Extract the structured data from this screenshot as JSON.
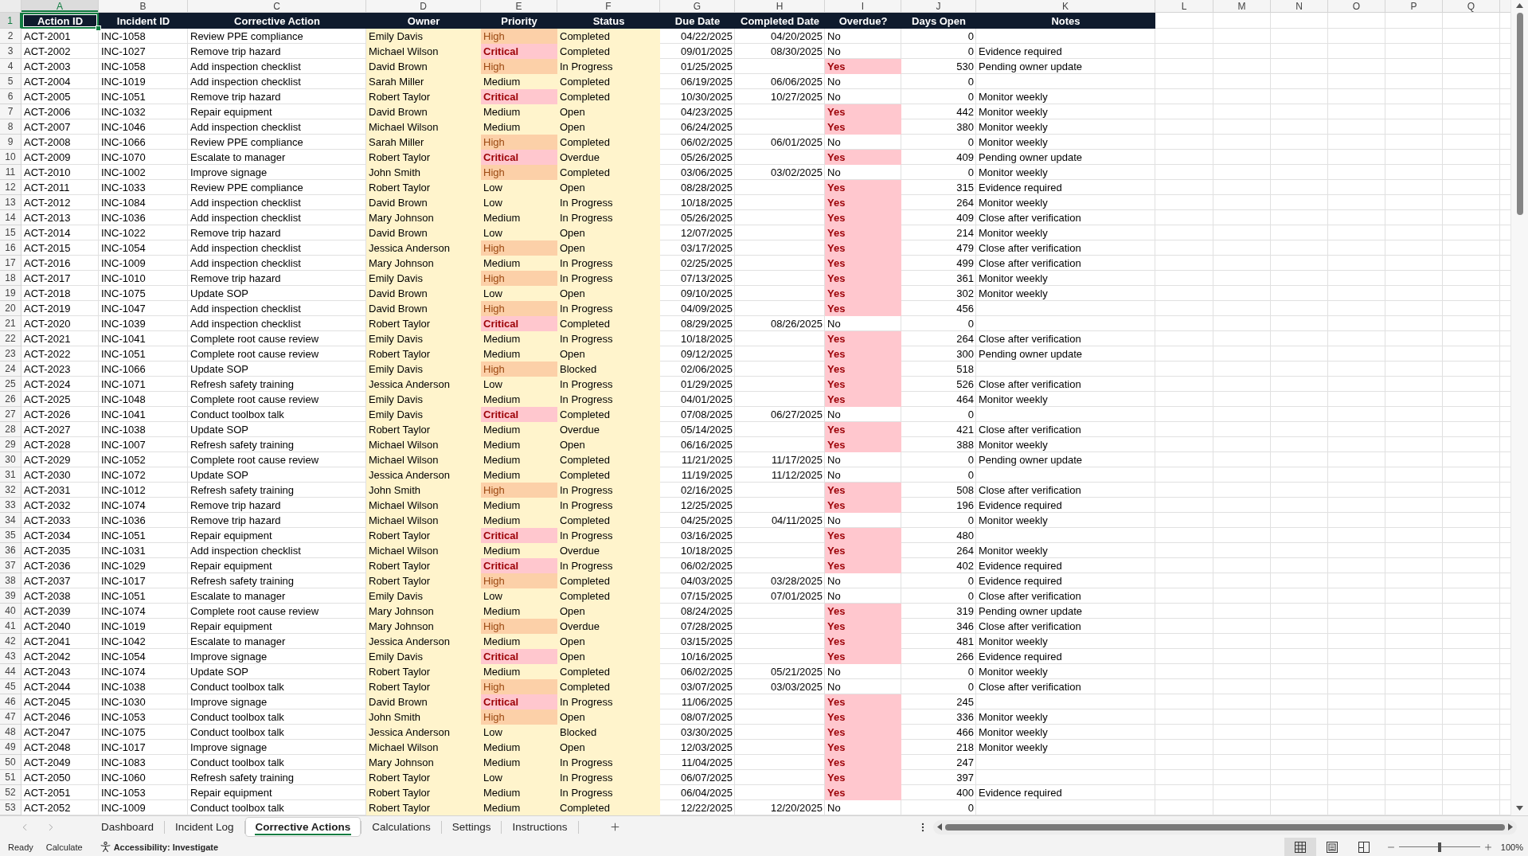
{
  "column_letters": [
    {
      "label": "A",
      "selected": true
    },
    {
      "label": "B",
      "selected": false
    },
    {
      "label": "C",
      "selected": false
    },
    {
      "label": "D",
      "selected": false
    },
    {
      "label": "E",
      "selected": false
    },
    {
      "label": "F",
      "selected": false
    },
    {
      "label": "G",
      "selected": false
    },
    {
      "label": "H",
      "selected": false
    },
    {
      "label": "I",
      "selected": false
    },
    {
      "label": "J",
      "selected": false
    },
    {
      "label": "K",
      "selected": false
    },
    {
      "label": "L",
      "selected": false
    },
    {
      "label": "M",
      "selected": false
    },
    {
      "label": "N",
      "selected": false
    },
    {
      "label": "O",
      "selected": false
    },
    {
      "label": "P",
      "selected": false
    },
    {
      "label": "Q",
      "selected": false
    }
  ],
  "row_headers": [
    {
      "label": "1",
      "selected": true
    },
    {
      "label": "2",
      "selected": false
    },
    {
      "label": "3",
      "selected": false
    },
    {
      "label": "4",
      "selected": false
    },
    {
      "label": "5",
      "selected": false
    },
    {
      "label": "6",
      "selected": false
    },
    {
      "label": "7",
      "selected": false
    },
    {
      "label": "8",
      "selected": false
    },
    {
      "label": "9",
      "selected": false
    },
    {
      "label": "10",
      "selected": false
    },
    {
      "label": "11",
      "selected": false
    },
    {
      "label": "12",
      "selected": false
    },
    {
      "label": "13",
      "selected": false
    },
    {
      "label": "14",
      "selected": false
    },
    {
      "label": "15",
      "selected": false
    },
    {
      "label": "16",
      "selected": false
    },
    {
      "label": "17",
      "selected": false
    },
    {
      "label": "18",
      "selected": false
    },
    {
      "label": "19",
      "selected": false
    },
    {
      "label": "20",
      "selected": false
    },
    {
      "label": "21",
      "selected": false
    },
    {
      "label": "22",
      "selected": false
    },
    {
      "label": "23",
      "selected": false
    },
    {
      "label": "24",
      "selected": false
    },
    {
      "label": "25",
      "selected": false
    },
    {
      "label": "26",
      "selected": false
    },
    {
      "label": "27",
      "selected": false
    },
    {
      "label": "28",
      "selected": false
    },
    {
      "label": "29",
      "selected": false
    },
    {
      "label": "30",
      "selected": false
    },
    {
      "label": "31",
      "selected": false
    },
    {
      "label": "32",
      "selected": false
    },
    {
      "label": "33",
      "selected": false
    },
    {
      "label": "34",
      "selected": false
    },
    {
      "label": "35",
      "selected": false
    },
    {
      "label": "36",
      "selected": false
    },
    {
      "label": "37",
      "selected": false
    },
    {
      "label": "38",
      "selected": false
    },
    {
      "label": "39",
      "selected": false
    },
    {
      "label": "40",
      "selected": false
    },
    {
      "label": "41",
      "selected": false
    },
    {
      "label": "42",
      "selected": false
    },
    {
      "label": "43",
      "selected": false
    },
    {
      "label": "44",
      "selected": false
    },
    {
      "label": "45",
      "selected": false
    },
    {
      "label": "46",
      "selected": false
    },
    {
      "label": "47",
      "selected": false
    },
    {
      "label": "48",
      "selected": false
    },
    {
      "label": "49",
      "selected": false
    },
    {
      "label": "50",
      "selected": false
    },
    {
      "label": "51",
      "selected": false
    },
    {
      "label": "52",
      "selected": false
    },
    {
      "label": "53",
      "selected": false
    }
  ],
  "table": {
    "columns": [
      "Action ID",
      "Incident ID",
      "Corrective Action",
      "Owner",
      "Priority",
      "Status",
      "Due Date",
      "Completed Date",
      "Overdue?",
      "Days Open",
      "Notes"
    ],
    "rows": [
      {
        "action_id": "ACT-2001",
        "incident_id": "INC-1058",
        "corrective_action": "Review PPE compliance",
        "owner": "Emily Davis",
        "priority": {
          "label": "High",
          "kind": "high"
        },
        "status": "Completed",
        "due_date": "04/22/2025",
        "completed_date": "04/20/2025",
        "overdue": {
          "label": "No",
          "flagged": false
        },
        "days_open": "0"
      },
      {
        "action_id": "ACT-2002",
        "incident_id": "INC-1027",
        "corrective_action": "Remove trip hazard",
        "owner": "Michael Wilson",
        "priority": {
          "label": "Critical",
          "kind": "critical"
        },
        "status": "Completed",
        "due_date": "09/01/2025",
        "completed_date": "08/30/2025",
        "overdue": {
          "label": "No",
          "flagged": false
        },
        "days_open": "0",
        "notes": "Evidence required"
      },
      {
        "action_id": "ACT-2003",
        "incident_id": "INC-1058",
        "corrective_action": "Add inspection checklist",
        "owner": "David Brown",
        "priority": {
          "label": "High",
          "kind": "high"
        },
        "status": "In Progress",
        "due_date": "01/25/2025",
        "overdue": {
          "label": "Yes",
          "flagged": true
        },
        "days_open": "530",
        "notes": "Pending owner update"
      },
      {
        "action_id": "ACT-2004",
        "incident_id": "INC-1019",
        "corrective_action": "Add inspection checklist",
        "owner": "Sarah Miller",
        "priority": {
          "label": "Medium",
          "kind": "normal"
        },
        "status": "Completed",
        "due_date": "06/19/2025",
        "completed_date": "06/06/2025",
        "overdue": {
          "label": "No",
          "flagged": false
        },
        "days_open": "0"
      },
      {
        "action_id": "ACT-2005",
        "incident_id": "INC-1051",
        "corrective_action": "Remove trip hazard",
        "owner": "Robert Taylor",
        "priority": {
          "label": "Critical",
          "kind": "critical"
        },
        "status": "Completed",
        "due_date": "10/30/2025",
        "completed_date": "10/27/2025",
        "overdue": {
          "label": "No",
          "flagged": false
        },
        "days_open": "0",
        "notes": "Monitor weekly"
      },
      {
        "action_id": "ACT-2006",
        "incident_id": "INC-1032",
        "corrective_action": "Repair equipment",
        "owner": "David Brown",
        "priority": {
          "label": "Medium",
          "kind": "normal"
        },
        "status": "Open",
        "due_date": "04/23/2025",
        "overdue": {
          "label": "Yes",
          "flagged": true
        },
        "days_open": "442",
        "notes": "Monitor weekly"
      },
      {
        "action_id": "ACT-2007",
        "incident_id": "INC-1046",
        "corrective_action": "Add inspection checklist",
        "owner": "Michael Wilson",
        "priority": {
          "label": "Medium",
          "kind": "normal"
        },
        "status": "Open",
        "due_date": "06/24/2025",
        "overdue": {
          "label": "Yes",
          "flagged": true
        },
        "days_open": "380",
        "notes": "Monitor weekly"
      },
      {
        "action_id": "ACT-2008",
        "incident_id": "INC-1066",
        "corrective_action": "Review PPE compliance",
        "owner": "Sarah Miller",
        "priority": {
          "label": "High",
          "kind": "high"
        },
        "status": "Completed",
        "due_date": "06/02/2025",
        "completed_date": "06/01/2025",
        "overdue": {
          "label": "No",
          "flagged": false
        },
        "days_open": "0",
        "notes": "Monitor weekly"
      },
      {
        "action_id": "ACT-2009",
        "incident_id": "INC-1070",
        "corrective_action": "Escalate to manager",
        "owner": "Robert Taylor",
        "priority": {
          "label": "Critical",
          "kind": "critical"
        },
        "status": "Overdue",
        "due_date": "05/26/2025",
        "overdue": {
          "label": "Yes",
          "flagged": true
        },
        "days_open": "409",
        "notes": "Pending owner update"
      },
      {
        "action_id": "ACT-2010",
        "incident_id": "INC-1002",
        "corrective_action": "Improve signage",
        "owner": "John Smith",
        "priority": {
          "label": "High",
          "kind": "high"
        },
        "status": "Completed",
        "due_date": "03/06/2025",
        "completed_date": "03/02/2025",
        "overdue": {
          "label": "No",
          "flagged": false
        },
        "days_open": "0",
        "notes": "Monitor weekly"
      },
      {
        "action_id": "ACT-2011",
        "incident_id": "INC-1033",
        "corrective_action": "Review PPE compliance",
        "owner": "Robert Taylor",
        "priority": {
          "label": "Low",
          "kind": "normal"
        },
        "status": "Open",
        "due_date": "08/28/2025",
        "overdue": {
          "label": "Yes",
          "flagged": true
        },
        "days_open": "315",
        "notes": "Evidence required"
      },
      {
        "action_id": "ACT-2012",
        "incident_id": "INC-1084",
        "corrective_action": "Add inspection checklist",
        "owner": "David Brown",
        "priority": {
          "label": "Low",
          "kind": "normal"
        },
        "status": "In Progress",
        "due_date": "10/18/2025",
        "overdue": {
          "label": "Yes",
          "flagged": true
        },
        "days_open": "264",
        "notes": "Monitor weekly"
      },
      {
        "action_id": "ACT-2013",
        "incident_id": "INC-1036",
        "corrective_action": "Add inspection checklist",
        "owner": "Mary Johnson",
        "priority": {
          "label": "Medium",
          "kind": "normal"
        },
        "status": "In Progress",
        "due_date": "05/26/2025",
        "overdue": {
          "label": "Yes",
          "flagged": true
        },
        "days_open": "409",
        "notes": "Close after verification"
      },
      {
        "action_id": "ACT-2014",
        "incident_id": "INC-1022",
        "corrective_action": "Remove trip hazard",
        "owner": "David Brown",
        "priority": {
          "label": "Low",
          "kind": "normal"
        },
        "status": "Open",
        "due_date": "12/07/2025",
        "overdue": {
          "label": "Yes",
          "flagged": true
        },
        "days_open": "214",
        "notes": "Monitor weekly"
      },
      {
        "action_id": "ACT-2015",
        "incident_id": "INC-1054",
        "corrective_action": "Add inspection checklist",
        "owner": "Jessica Anderson",
        "priority": {
          "label": "High",
          "kind": "high"
        },
        "status": "Open",
        "due_date": "03/17/2025",
        "overdue": {
          "label": "Yes",
          "flagged": true
        },
        "days_open": "479",
        "notes": "Close after verification"
      },
      {
        "action_id": "ACT-2016",
        "incident_id": "INC-1009",
        "corrective_action": "Add inspection checklist",
        "owner": "Mary Johnson",
        "priority": {
          "label": "Medium",
          "kind": "normal"
        },
        "status": "In Progress",
        "due_date": "02/25/2025",
        "overdue": {
          "label": "Yes",
          "flagged": true
        },
        "days_open": "499",
        "notes": "Close after verification"
      },
      {
        "action_id": "ACT-2017",
        "incident_id": "INC-1010",
        "corrective_action": "Remove trip hazard",
        "owner": "Emily Davis",
        "priority": {
          "label": "High",
          "kind": "high"
        },
        "status": "In Progress",
        "due_date": "07/13/2025",
        "overdue": {
          "label": "Yes",
          "flagged": true
        },
        "days_open": "361",
        "notes": "Monitor weekly"
      },
      {
        "action_id": "ACT-2018",
        "incident_id": "INC-1075",
        "corrective_action": "Update SOP",
        "owner": "David Brown",
        "priority": {
          "label": "Low",
          "kind": "normal"
        },
        "status": "Open",
        "due_date": "09/10/2025",
        "overdue": {
          "label": "Yes",
          "flagged": true
        },
        "days_open": "302",
        "notes": "Monitor weekly"
      },
      {
        "action_id": "ACT-2019",
        "incident_id": "INC-1047",
        "corrective_action": "Add inspection checklist",
        "owner": "David Brown",
        "priority": {
          "label": "High",
          "kind": "high"
        },
        "status": "In Progress",
        "due_date": "04/09/2025",
        "overdue": {
          "label": "Yes",
          "flagged": true
        },
        "days_open": "456"
      },
      {
        "action_id": "ACT-2020",
        "incident_id": "INC-1039",
        "corrective_action": "Add inspection checklist",
        "owner": "Robert Taylor",
        "priority": {
          "label": "Critical",
          "kind": "critical"
        },
        "status": "Completed",
        "due_date": "08/29/2025",
        "completed_date": "08/26/2025",
        "overdue": {
          "label": "No",
          "flagged": false
        },
        "days_open": "0"
      },
      {
        "action_id": "ACT-2021",
        "incident_id": "INC-1041",
        "corrective_action": "Complete root cause review",
        "owner": "Emily Davis",
        "priority": {
          "label": "Medium",
          "kind": "normal"
        },
        "status": "In Progress",
        "due_date": "10/18/2025",
        "overdue": {
          "label": "Yes",
          "flagged": true
        },
        "days_open": "264",
        "notes": "Close after verification"
      },
      {
        "action_id": "ACT-2022",
        "incident_id": "INC-1051",
        "corrective_action": "Complete root cause review",
        "owner": "Robert Taylor",
        "priority": {
          "label": "Medium",
          "kind": "normal"
        },
        "status": "Open",
        "due_date": "09/12/2025",
        "overdue": {
          "label": "Yes",
          "flagged": true
        },
        "days_open": "300",
        "notes": "Pending owner update"
      },
      {
        "action_id": "ACT-2023",
        "incident_id": "INC-1066",
        "corrective_action": "Update SOP",
        "owner": "Emily Davis",
        "priority": {
          "label": "High",
          "kind": "high"
        },
        "status": "Blocked",
        "due_date": "02/06/2025",
        "overdue": {
          "label": "Yes",
          "flagged": true
        },
        "days_open": "518"
      },
      {
        "action_id": "ACT-2024",
        "incident_id": "INC-1071",
        "corrective_action": "Refresh safety training",
        "owner": "Jessica Anderson",
        "priority": {
          "label": "Low",
          "kind": "normal"
        },
        "status": "In Progress",
        "due_date": "01/29/2025",
        "overdue": {
          "label": "Yes",
          "flagged": true
        },
        "days_open": "526",
        "notes": "Close after verification"
      },
      {
        "action_id": "ACT-2025",
        "incident_id": "INC-1048",
        "corrective_action": "Complete root cause review",
        "owner": "Emily Davis",
        "priority": {
          "label": "Medium",
          "kind": "normal"
        },
        "status": "In Progress",
        "due_date": "04/01/2025",
        "overdue": {
          "label": "Yes",
          "flagged": true
        },
        "days_open": "464",
        "notes": "Monitor weekly"
      },
      {
        "action_id": "ACT-2026",
        "incident_id": "INC-1041",
        "corrective_action": "Conduct toolbox talk",
        "owner": "Emily Davis",
        "priority": {
          "label": "Critical",
          "kind": "critical"
        },
        "status": "Completed",
        "due_date": "07/08/2025",
        "completed_date": "06/27/2025",
        "overdue": {
          "label": "No",
          "flagged": false
        },
        "days_open": "0"
      },
      {
        "action_id": "ACT-2027",
        "incident_id": "INC-1038",
        "corrective_action": "Update SOP",
        "owner": "Robert Taylor",
        "priority": {
          "label": "Medium",
          "kind": "normal"
        },
        "status": "Overdue",
        "due_date": "05/14/2025",
        "overdue": {
          "label": "Yes",
          "flagged": true
        },
        "days_open": "421",
        "notes": "Close after verification"
      },
      {
        "action_id": "ACT-2028",
        "incident_id": "INC-1007",
        "corrective_action": "Refresh safety training",
        "owner": "Michael Wilson",
        "priority": {
          "label": "Medium",
          "kind": "normal"
        },
        "status": "Open",
        "due_date": "06/16/2025",
        "overdue": {
          "label": "Yes",
          "flagged": true
        },
        "days_open": "388",
        "notes": "Monitor weekly"
      },
      {
        "action_id": "ACT-2029",
        "incident_id": "INC-1052",
        "corrective_action": "Complete root cause review",
        "owner": "Michael Wilson",
        "priority": {
          "label": "Medium",
          "kind": "normal"
        },
        "status": "Completed",
        "due_date": "11/21/2025",
        "completed_date": "11/17/2025",
        "overdue": {
          "label": "No",
          "flagged": false
        },
        "days_open": "0",
        "notes": "Pending owner update"
      },
      {
        "action_id": "ACT-2030",
        "incident_id": "INC-1072",
        "corrective_action": "Update SOP",
        "owner": "Jessica Anderson",
        "priority": {
          "label": "Medium",
          "kind": "normal"
        },
        "status": "Completed",
        "due_date": "11/19/2025",
        "completed_date": "11/12/2025",
        "overdue": {
          "label": "No",
          "flagged": false
        },
        "days_open": "0"
      },
      {
        "action_id": "ACT-2031",
        "incident_id": "INC-1012",
        "corrective_action": "Refresh safety training",
        "owner": "John Smith",
        "priority": {
          "label": "High",
          "kind": "high"
        },
        "status": "In Progress",
        "due_date": "02/16/2025",
        "overdue": {
          "label": "Yes",
          "flagged": true
        },
        "days_open": "508",
        "notes": "Close after verification"
      },
      {
        "action_id": "ACT-2032",
        "incident_id": "INC-1074",
        "corrective_action": "Remove trip hazard",
        "owner": "Michael Wilson",
        "priority": {
          "label": "Medium",
          "kind": "normal"
        },
        "status": "In Progress",
        "due_date": "12/25/2025",
        "overdue": {
          "label": "Yes",
          "flagged": true
        },
        "days_open": "196",
        "notes": "Evidence required"
      },
      {
        "action_id": "ACT-2033",
        "incident_id": "INC-1036",
        "corrective_action": "Remove trip hazard",
        "owner": "Michael Wilson",
        "priority": {
          "label": "Medium",
          "kind": "normal"
        },
        "status": "Completed",
        "due_date": "04/25/2025",
        "completed_date": "04/11/2025",
        "overdue": {
          "label": "No",
          "flagged": false
        },
        "days_open": "0",
        "notes": "Monitor weekly"
      },
      {
        "action_id": "ACT-2034",
        "incident_id": "INC-1051",
        "corrective_action": "Repair equipment",
        "owner": "Robert Taylor",
        "priority": {
          "label": "Critical",
          "kind": "critical"
        },
        "status": "In Progress",
        "due_date": "03/16/2025",
        "overdue": {
          "label": "Yes",
          "flagged": true
        },
        "days_open": "480"
      },
      {
        "action_id": "ACT-2035",
        "incident_id": "INC-1031",
        "corrective_action": "Add inspection checklist",
        "owner": "Michael Wilson",
        "priority": {
          "label": "Medium",
          "kind": "normal"
        },
        "status": "Overdue",
        "due_date": "10/18/2025",
        "overdue": {
          "label": "Yes",
          "flagged": true
        },
        "days_open": "264",
        "notes": "Monitor weekly"
      },
      {
        "action_id": "ACT-2036",
        "incident_id": "INC-1029",
        "corrective_action": "Repair equipment",
        "owner": "Robert Taylor",
        "priority": {
          "label": "Critical",
          "kind": "critical"
        },
        "status": "In Progress",
        "due_date": "06/02/2025",
        "overdue": {
          "label": "Yes",
          "flagged": true
        },
        "days_open": "402",
        "notes": "Evidence required"
      },
      {
        "action_id": "ACT-2037",
        "incident_id": "INC-1017",
        "corrective_action": "Refresh safety training",
        "owner": "Robert Taylor",
        "priority": {
          "label": "High",
          "kind": "high"
        },
        "status": "Completed",
        "due_date": "04/03/2025",
        "completed_date": "03/28/2025",
        "overdue": {
          "label": "No",
          "flagged": false
        },
        "days_open": "0",
        "notes": "Evidence required"
      },
      {
        "action_id": "ACT-2038",
        "incident_id": "INC-1051",
        "corrective_action": "Escalate to manager",
        "owner": "Emily Davis",
        "priority": {
          "label": "Low",
          "kind": "normal"
        },
        "status": "Completed",
        "due_date": "07/15/2025",
        "completed_date": "07/01/2025",
        "overdue": {
          "label": "No",
          "flagged": false
        },
        "days_open": "0",
        "notes": "Close after verification"
      },
      {
        "action_id": "ACT-2039",
        "incident_id": "INC-1074",
        "corrective_action": "Complete root cause review",
        "owner": "Mary Johnson",
        "priority": {
          "label": "Medium",
          "kind": "normal"
        },
        "status": "Open",
        "due_date": "08/24/2025",
        "overdue": {
          "label": "Yes",
          "flagged": true
        },
        "days_open": "319",
        "notes": "Pending owner update"
      },
      {
        "action_id": "ACT-2040",
        "incident_id": "INC-1019",
        "corrective_action": "Repair equipment",
        "owner": "Mary Johnson",
        "priority": {
          "label": "High",
          "kind": "high"
        },
        "status": "Overdue",
        "due_date": "07/28/2025",
        "overdue": {
          "label": "Yes",
          "flagged": true
        },
        "days_open": "346",
        "notes": "Close after verification"
      },
      {
        "action_id": "ACT-2041",
        "incident_id": "INC-1042",
        "corrective_action": "Escalate to manager",
        "owner": "Jessica Anderson",
        "priority": {
          "label": "Medium",
          "kind": "normal"
        },
        "status": "Open",
        "due_date": "03/15/2025",
        "overdue": {
          "label": "Yes",
          "flagged": true
        },
        "days_open": "481",
        "notes": "Monitor weekly"
      },
      {
        "action_id": "ACT-2042",
        "incident_id": "INC-1054",
        "corrective_action": "Improve signage",
        "owner": "Emily Davis",
        "priority": {
          "label": "Critical",
          "kind": "critical"
        },
        "status": "Open",
        "due_date": "10/16/2025",
        "overdue": {
          "label": "Yes",
          "flagged": true
        },
        "days_open": "266",
        "notes": "Evidence required"
      },
      {
        "action_id": "ACT-2043",
        "incident_id": "INC-1074",
        "corrective_action": "Update SOP",
        "owner": "Robert Taylor",
        "priority": {
          "label": "Medium",
          "kind": "normal"
        },
        "status": "Completed",
        "due_date": "06/02/2025",
        "completed_date": "05/21/2025",
        "overdue": {
          "label": "No",
          "flagged": false
        },
        "days_open": "0",
        "notes": "Monitor weekly"
      },
      {
        "action_id": "ACT-2044",
        "incident_id": "INC-1038",
        "corrective_action": "Conduct toolbox talk",
        "owner": "Robert Taylor",
        "priority": {
          "label": "High",
          "kind": "high"
        },
        "status": "Completed",
        "due_date": "03/07/2025",
        "completed_date": "03/03/2025",
        "overdue": {
          "label": "No",
          "flagged": false
        },
        "days_open": "0",
        "notes": "Close after verification"
      },
      {
        "action_id": "ACT-2045",
        "incident_id": "INC-1030",
        "corrective_action": "Improve signage",
        "owner": "David Brown",
        "priority": {
          "label": "Critical",
          "kind": "critical"
        },
        "status": "In Progress",
        "due_date": "11/06/2025",
        "overdue": {
          "label": "Yes",
          "flagged": true
        },
        "days_open": "245"
      },
      {
        "action_id": "ACT-2046",
        "incident_id": "INC-1053",
        "corrective_action": "Conduct toolbox talk",
        "owner": "John Smith",
        "priority": {
          "label": "High",
          "kind": "high"
        },
        "status": "Open",
        "due_date": "08/07/2025",
        "overdue": {
          "label": "Yes",
          "flagged": true
        },
        "days_open": "336",
        "notes": "Monitor weekly"
      },
      {
        "action_id": "ACT-2047",
        "incident_id": "INC-1075",
        "corrective_action": "Conduct toolbox talk",
        "owner": "Jessica Anderson",
        "priority": {
          "label": "Low",
          "kind": "normal"
        },
        "status": "Blocked",
        "due_date": "03/30/2025",
        "overdue": {
          "label": "Yes",
          "flagged": true
        },
        "days_open": "466",
        "notes": "Monitor weekly"
      },
      {
        "action_id": "ACT-2048",
        "incident_id": "INC-1017",
        "corrective_action": "Improve signage",
        "owner": "Michael Wilson",
        "priority": {
          "label": "Medium",
          "kind": "normal"
        },
        "status": "Open",
        "due_date": "12/03/2025",
        "overdue": {
          "label": "Yes",
          "flagged": true
        },
        "days_open": "218",
        "notes": "Monitor weekly"
      },
      {
        "action_id": "ACT-2049",
        "incident_id": "INC-1083",
        "corrective_action": "Conduct toolbox talk",
        "owner": "Mary Johnson",
        "priority": {
          "label": "Medium",
          "kind": "normal"
        },
        "status": "In Progress",
        "due_date": "11/04/2025",
        "overdue": {
          "label": "Yes",
          "flagged": true
        },
        "days_open": "247"
      },
      {
        "action_id": "ACT-2050",
        "incident_id": "INC-1060",
        "corrective_action": "Refresh safety training",
        "owner": "Robert Taylor",
        "priority": {
          "label": "Low",
          "kind": "normal"
        },
        "status": "In Progress",
        "due_date": "06/07/2025",
        "overdue": {
          "label": "Yes",
          "flagged": true
        },
        "days_open": "397"
      },
      {
        "action_id": "ACT-2051",
        "incident_id": "INC-1053",
        "corrective_action": "Repair equipment",
        "owner": "Robert Taylor",
        "priority": {
          "label": "Medium",
          "kind": "normal"
        },
        "status": "In Progress",
        "due_date": "06/04/2025",
        "overdue": {
          "label": "Yes",
          "flagged": true
        },
        "days_open": "400",
        "notes": "Evidence required"
      },
      {
        "action_id": "ACT-2052",
        "incident_id": "INC-1009",
        "corrective_action": "Conduct toolbox talk",
        "owner": "Robert Taylor",
        "priority": {
          "label": "Medium",
          "kind": "normal"
        },
        "status": "Completed",
        "due_date": "12/22/2025",
        "completed_date": "12/20/2025",
        "overdue": {
          "label": "No",
          "flagged": false
        },
        "days_open": "0"
      }
    ]
  },
  "sheet_tabs": [
    {
      "label": "Dashboard",
      "selected": false
    },
    {
      "label": "Incident Log",
      "selected": false
    },
    {
      "label": "Corrective Actions",
      "selected": true
    },
    {
      "label": "Calculations",
      "selected": false
    },
    {
      "label": "Settings",
      "selected": false
    },
    {
      "label": "Instructions",
      "selected": false
    }
  ],
  "status_bar": {
    "mode": "Ready",
    "calculate": "Calculate",
    "accessibility": "Accessibility: Investigate",
    "views": [
      {
        "kind": "normal",
        "selected": true
      },
      {
        "kind": "page_layout",
        "selected": false
      },
      {
        "kind": "page_break_preview",
        "selected": false
      }
    ],
    "zoom": {
      "level": 0.5,
      "reading": "100%"
    }
  }
}
